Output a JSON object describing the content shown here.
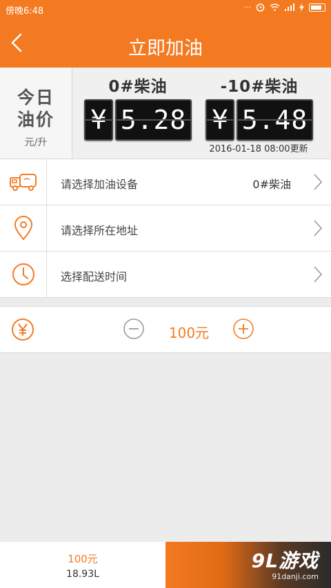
{
  "status_bar": {
    "time": "傍晚6:48"
  },
  "header": {
    "title": "立即加油"
  },
  "prices": {
    "today_line1": "今日",
    "today_line2": "油价",
    "unit": "元/升",
    "fuels": [
      {
        "name": "0#柴油",
        "currency": "¥",
        "price": "5.28"
      },
      {
        "name": "-10#柴油",
        "currency": "¥",
        "price": "5.48"
      }
    ],
    "updated": "2016-01-18 08:00更新"
  },
  "rows": [
    {
      "icon": "truck-icon",
      "label": "请选择加油设备",
      "value": "0#柴油"
    },
    {
      "icon": "location-pin-icon",
      "label": "请选择所在地址",
      "value": ""
    },
    {
      "icon": "clock-icon",
      "label": "选择配送时间",
      "value": ""
    }
  ],
  "amount": {
    "icon": "yuan-icon",
    "value": "100元"
  },
  "footer": {
    "amount": "100元",
    "liters": "18.93L"
  },
  "watermark": {
    "brand": "9L游戏",
    "site": "91danji.com"
  },
  "colors": {
    "accent": "#f47a22"
  }
}
